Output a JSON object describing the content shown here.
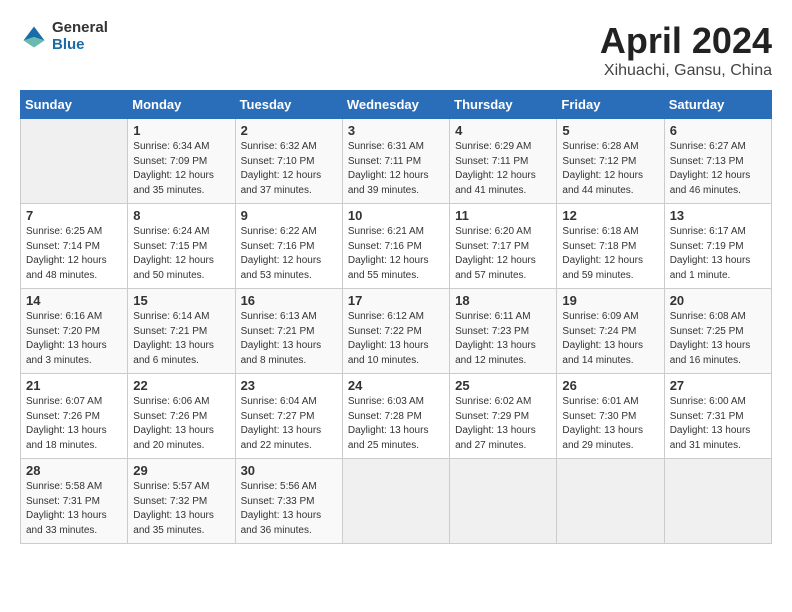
{
  "logo": {
    "general": "General",
    "blue": "Blue"
  },
  "title": "April 2024",
  "subtitle": "Xihuachi, Gansu, China",
  "weekdays": [
    "Sunday",
    "Monday",
    "Tuesday",
    "Wednesday",
    "Thursday",
    "Friday",
    "Saturday"
  ],
  "weeks": [
    [
      {
        "day": "",
        "info": ""
      },
      {
        "day": "1",
        "info": "Sunrise: 6:34 AM\nSunset: 7:09 PM\nDaylight: 12 hours\nand 35 minutes."
      },
      {
        "day": "2",
        "info": "Sunrise: 6:32 AM\nSunset: 7:10 PM\nDaylight: 12 hours\nand 37 minutes."
      },
      {
        "day": "3",
        "info": "Sunrise: 6:31 AM\nSunset: 7:11 PM\nDaylight: 12 hours\nand 39 minutes."
      },
      {
        "day": "4",
        "info": "Sunrise: 6:29 AM\nSunset: 7:11 PM\nDaylight: 12 hours\nand 41 minutes."
      },
      {
        "day": "5",
        "info": "Sunrise: 6:28 AM\nSunset: 7:12 PM\nDaylight: 12 hours\nand 44 minutes."
      },
      {
        "day": "6",
        "info": "Sunrise: 6:27 AM\nSunset: 7:13 PM\nDaylight: 12 hours\nand 46 minutes."
      }
    ],
    [
      {
        "day": "7",
        "info": "Sunrise: 6:25 AM\nSunset: 7:14 PM\nDaylight: 12 hours\nand 48 minutes."
      },
      {
        "day": "8",
        "info": "Sunrise: 6:24 AM\nSunset: 7:15 PM\nDaylight: 12 hours\nand 50 minutes."
      },
      {
        "day": "9",
        "info": "Sunrise: 6:22 AM\nSunset: 7:16 PM\nDaylight: 12 hours\nand 53 minutes."
      },
      {
        "day": "10",
        "info": "Sunrise: 6:21 AM\nSunset: 7:16 PM\nDaylight: 12 hours\nand 55 minutes."
      },
      {
        "day": "11",
        "info": "Sunrise: 6:20 AM\nSunset: 7:17 PM\nDaylight: 12 hours\nand 57 minutes."
      },
      {
        "day": "12",
        "info": "Sunrise: 6:18 AM\nSunset: 7:18 PM\nDaylight: 12 hours\nand 59 minutes."
      },
      {
        "day": "13",
        "info": "Sunrise: 6:17 AM\nSunset: 7:19 PM\nDaylight: 13 hours\nand 1 minute."
      }
    ],
    [
      {
        "day": "14",
        "info": "Sunrise: 6:16 AM\nSunset: 7:20 PM\nDaylight: 13 hours\nand 3 minutes."
      },
      {
        "day": "15",
        "info": "Sunrise: 6:14 AM\nSunset: 7:21 PM\nDaylight: 13 hours\nand 6 minutes."
      },
      {
        "day": "16",
        "info": "Sunrise: 6:13 AM\nSunset: 7:21 PM\nDaylight: 13 hours\nand 8 minutes."
      },
      {
        "day": "17",
        "info": "Sunrise: 6:12 AM\nSunset: 7:22 PM\nDaylight: 13 hours\nand 10 minutes."
      },
      {
        "day": "18",
        "info": "Sunrise: 6:11 AM\nSunset: 7:23 PM\nDaylight: 13 hours\nand 12 minutes."
      },
      {
        "day": "19",
        "info": "Sunrise: 6:09 AM\nSunset: 7:24 PM\nDaylight: 13 hours\nand 14 minutes."
      },
      {
        "day": "20",
        "info": "Sunrise: 6:08 AM\nSunset: 7:25 PM\nDaylight: 13 hours\nand 16 minutes."
      }
    ],
    [
      {
        "day": "21",
        "info": "Sunrise: 6:07 AM\nSunset: 7:26 PM\nDaylight: 13 hours\nand 18 minutes."
      },
      {
        "day": "22",
        "info": "Sunrise: 6:06 AM\nSunset: 7:26 PM\nDaylight: 13 hours\nand 20 minutes."
      },
      {
        "day": "23",
        "info": "Sunrise: 6:04 AM\nSunset: 7:27 PM\nDaylight: 13 hours\nand 22 minutes."
      },
      {
        "day": "24",
        "info": "Sunrise: 6:03 AM\nSunset: 7:28 PM\nDaylight: 13 hours\nand 25 minutes."
      },
      {
        "day": "25",
        "info": "Sunrise: 6:02 AM\nSunset: 7:29 PM\nDaylight: 13 hours\nand 27 minutes."
      },
      {
        "day": "26",
        "info": "Sunrise: 6:01 AM\nSunset: 7:30 PM\nDaylight: 13 hours\nand 29 minutes."
      },
      {
        "day": "27",
        "info": "Sunrise: 6:00 AM\nSunset: 7:31 PM\nDaylight: 13 hours\nand 31 minutes."
      }
    ],
    [
      {
        "day": "28",
        "info": "Sunrise: 5:58 AM\nSunset: 7:31 PM\nDaylight: 13 hours\nand 33 minutes."
      },
      {
        "day": "29",
        "info": "Sunrise: 5:57 AM\nSunset: 7:32 PM\nDaylight: 13 hours\nand 35 minutes."
      },
      {
        "day": "30",
        "info": "Sunrise: 5:56 AM\nSunset: 7:33 PM\nDaylight: 13 hours\nand 36 minutes."
      },
      {
        "day": "",
        "info": ""
      },
      {
        "day": "",
        "info": ""
      },
      {
        "day": "",
        "info": ""
      },
      {
        "day": "",
        "info": ""
      }
    ]
  ]
}
